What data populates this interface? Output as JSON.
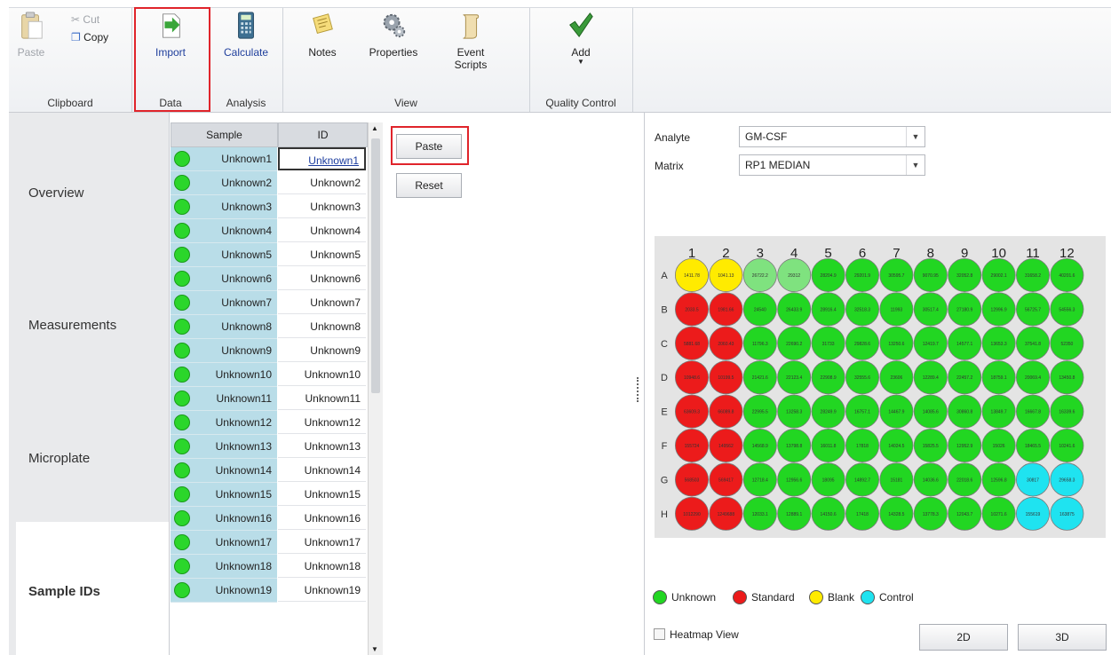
{
  "colors": {
    "unknown": "#22d622",
    "standard": "#ec1b1b",
    "blank": "#ffeb00",
    "control": "#1fe3f0",
    "unknown_light": "#7fe27f",
    "highlight": "#e0242b"
  },
  "ribbon": {
    "clipboard": {
      "group": "Clipboard",
      "paste": "Paste",
      "cut": "Cut",
      "copy": "Copy"
    },
    "data": {
      "group": "Data",
      "import": "Import"
    },
    "analysis": {
      "group": "Analysis",
      "calculate": "Calculate"
    },
    "view": {
      "group": "View",
      "notes": "Notes",
      "properties": "Properties",
      "event_line1": "Event",
      "event_line2": "Scripts"
    },
    "qc": {
      "group": "Quality Control",
      "add": "Add"
    }
  },
  "nav": {
    "items": [
      "Overview",
      "Measurements",
      "Microplate",
      "Sample IDs"
    ],
    "selected": "Sample IDs"
  },
  "grid": {
    "headers": {
      "sample": "Sample",
      "id": "ID"
    },
    "rows": [
      {
        "sample": "Unknown1",
        "id": "Unknown1"
      },
      {
        "sample": "Unknown2",
        "id": "Unknown2"
      },
      {
        "sample": "Unknown3",
        "id": "Unknown3"
      },
      {
        "sample": "Unknown4",
        "id": "Unknown4"
      },
      {
        "sample": "Unknown5",
        "id": "Unknown5"
      },
      {
        "sample": "Unknown6",
        "id": "Unknown6"
      },
      {
        "sample": "Unknown7",
        "id": "Unknown7"
      },
      {
        "sample": "Unknown8",
        "id": "Unknown8"
      },
      {
        "sample": "Unknown9",
        "id": "Unknown9"
      },
      {
        "sample": "Unknown10",
        "id": "Unknown10"
      },
      {
        "sample": "Unknown11",
        "id": "Unknown11"
      },
      {
        "sample": "Unknown12",
        "id": "Unknown12"
      },
      {
        "sample": "Unknown13",
        "id": "Unknown13"
      },
      {
        "sample": "Unknown14",
        "id": "Unknown14"
      },
      {
        "sample": "Unknown15",
        "id": "Unknown15"
      },
      {
        "sample": "Unknown16",
        "id": "Unknown16"
      },
      {
        "sample": "Unknown17",
        "id": "Unknown17"
      },
      {
        "sample": "Unknown18",
        "id": "Unknown18"
      },
      {
        "sample": "Unknown19",
        "id": "Unknown19"
      }
    ]
  },
  "buttons": {
    "paste": "Paste",
    "reset": "Reset",
    "btn2d": "2D",
    "btn3d": "3D"
  },
  "right": {
    "analyte_label": "Analyte",
    "analyte_value": "GM-CSF",
    "matrix_label": "Matrix",
    "matrix_value": "RP1 MEDIAN",
    "heatmap_label": "Heatmap View",
    "legend": {
      "unknown": "Unknown",
      "standard": "Standard",
      "blank": "Blank",
      "control": "Control"
    }
  },
  "plate": {
    "cols": [
      "1",
      "2",
      "3",
      "4",
      "5",
      "6",
      "7",
      "8",
      "9",
      "10",
      "11",
      "12"
    ],
    "rows": [
      "A",
      "B",
      "C",
      "D",
      "E",
      "F",
      "G",
      "H"
    ],
    "types": [
      [
        "blank",
        "blank",
        "unknown_light",
        "unknown_light",
        "unknown",
        "unknown",
        "unknown",
        "unknown",
        "unknown",
        "unknown",
        "unknown",
        "unknown"
      ],
      [
        "standard",
        "standard",
        "unknown",
        "unknown",
        "unknown",
        "unknown",
        "unknown",
        "unknown",
        "unknown",
        "unknown",
        "unknown",
        "unknown"
      ],
      [
        "standard",
        "standard",
        "unknown",
        "unknown",
        "unknown",
        "unknown",
        "unknown",
        "unknown",
        "unknown",
        "unknown",
        "unknown",
        "unknown"
      ],
      [
        "standard",
        "standard",
        "unknown",
        "unknown",
        "unknown",
        "unknown",
        "unknown",
        "unknown",
        "unknown",
        "unknown",
        "unknown",
        "unknown"
      ],
      [
        "standard",
        "standard",
        "unknown",
        "unknown",
        "unknown",
        "unknown",
        "unknown",
        "unknown",
        "unknown",
        "unknown",
        "unknown",
        "unknown"
      ],
      [
        "standard",
        "standard",
        "unknown",
        "unknown",
        "unknown",
        "unknown",
        "unknown",
        "unknown",
        "unknown",
        "unknown",
        "unknown",
        "unknown"
      ],
      [
        "standard",
        "standard",
        "unknown",
        "unknown",
        "unknown",
        "unknown",
        "unknown",
        "unknown",
        "unknown",
        "unknown",
        "control",
        "control"
      ],
      [
        "standard",
        "standard",
        "unknown",
        "unknown",
        "unknown",
        "unknown",
        "unknown",
        "unknown",
        "unknown",
        "unknown",
        "control",
        "control"
      ]
    ],
    "values": [
      [
        "1411.78",
        "1041.13",
        "26722.2",
        "29312",
        "28204.9",
        "29201.9",
        "30595.7",
        "9070.95",
        "32052.8",
        "29002.1",
        "31658.2",
        "40201.6"
      ],
      [
        "2033.5",
        "1981.66",
        "24540",
        "26433.9",
        "28916.4",
        "32518.3",
        "11993",
        "30517.4",
        "27180.9",
        "12996.9",
        "56725.7",
        "54556.3"
      ],
      [
        "5881.68",
        "2060.43",
        "11796.3",
        "22690.2",
        "31733",
        "29828.6",
        "13250.6",
        "12419.7",
        "14577.1",
        "13653.3",
        "37541.8",
        "52350"
      ],
      [
        "10948.6",
        "10199.5",
        "21421.6",
        "22123.4",
        "22908.9",
        "32555.6",
        "23606",
        "12289.4",
        "22457.2",
        "18759.1",
        "20069.4",
        "13450.8"
      ],
      [
        "63609.3",
        "66089.8",
        "22995.5",
        "13258.3",
        "28249.9",
        "16757.1",
        "14467.9",
        "14085.6",
        "30860.8",
        "13849.7",
        "16667.8",
        "16339.6"
      ],
      [
        "155724",
        "149562",
        "14568.9",
        "13798.8",
        "16011.8",
        "17818",
        "14024.5",
        "15825.5",
        "12952.9",
        "15026",
        "18465.5",
        "10241.6"
      ],
      [
        "568503",
        "569417",
        "12718.4",
        "12956.6",
        "18095",
        "14892.7",
        "15181",
        "14036.6",
        "22018.6",
        "12596.8",
        "30817",
        "29658.3"
      ],
      [
        "1012290",
        "1249688",
        "12033.1",
        "12889.1",
        "14150.6",
        "17418",
        "14328.5",
        "13778.3",
        "12043.7",
        "10271.6",
        "155619",
        "163875"
      ]
    ]
  }
}
